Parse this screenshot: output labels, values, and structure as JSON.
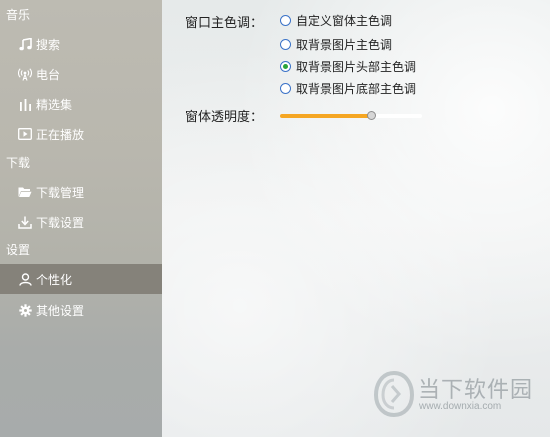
{
  "sidebar": {
    "sections": [
      {
        "header": "音乐",
        "items": [
          {
            "label": "搜索",
            "icon": "music-note-icon"
          },
          {
            "label": "电台",
            "icon": "radio-tower-icon"
          },
          {
            "label": "精选集",
            "icon": "bars-icon"
          },
          {
            "label": "正在播放",
            "icon": "play-icon"
          }
        ]
      },
      {
        "header": "下载",
        "items": [
          {
            "label": "下载管理",
            "icon": "folder-icon"
          },
          {
            "label": "下载设置",
            "icon": "download-icon"
          }
        ]
      },
      {
        "header": "设置",
        "items": [
          {
            "label": "个性化",
            "icon": "user-icon",
            "active": true
          },
          {
            "label": "其他设置",
            "icon": "gear-icon"
          }
        ]
      }
    ]
  },
  "main": {
    "color_label": "窗口主色调：",
    "color_options": [
      {
        "label": "自定义窗体主色调",
        "checked": false
      },
      {
        "label": "取背景图片主色调",
        "checked": false
      },
      {
        "label": "取背景图片头部主色调",
        "checked": true
      },
      {
        "label": "取背景图片底部主色调",
        "checked": false
      }
    ],
    "opacity_label": "窗体透明度：",
    "opacity_value": 0.64,
    "accent_color": "#f5a623"
  },
  "watermark": {
    "title": "当下软件园",
    "url": "www.downxia.com"
  }
}
